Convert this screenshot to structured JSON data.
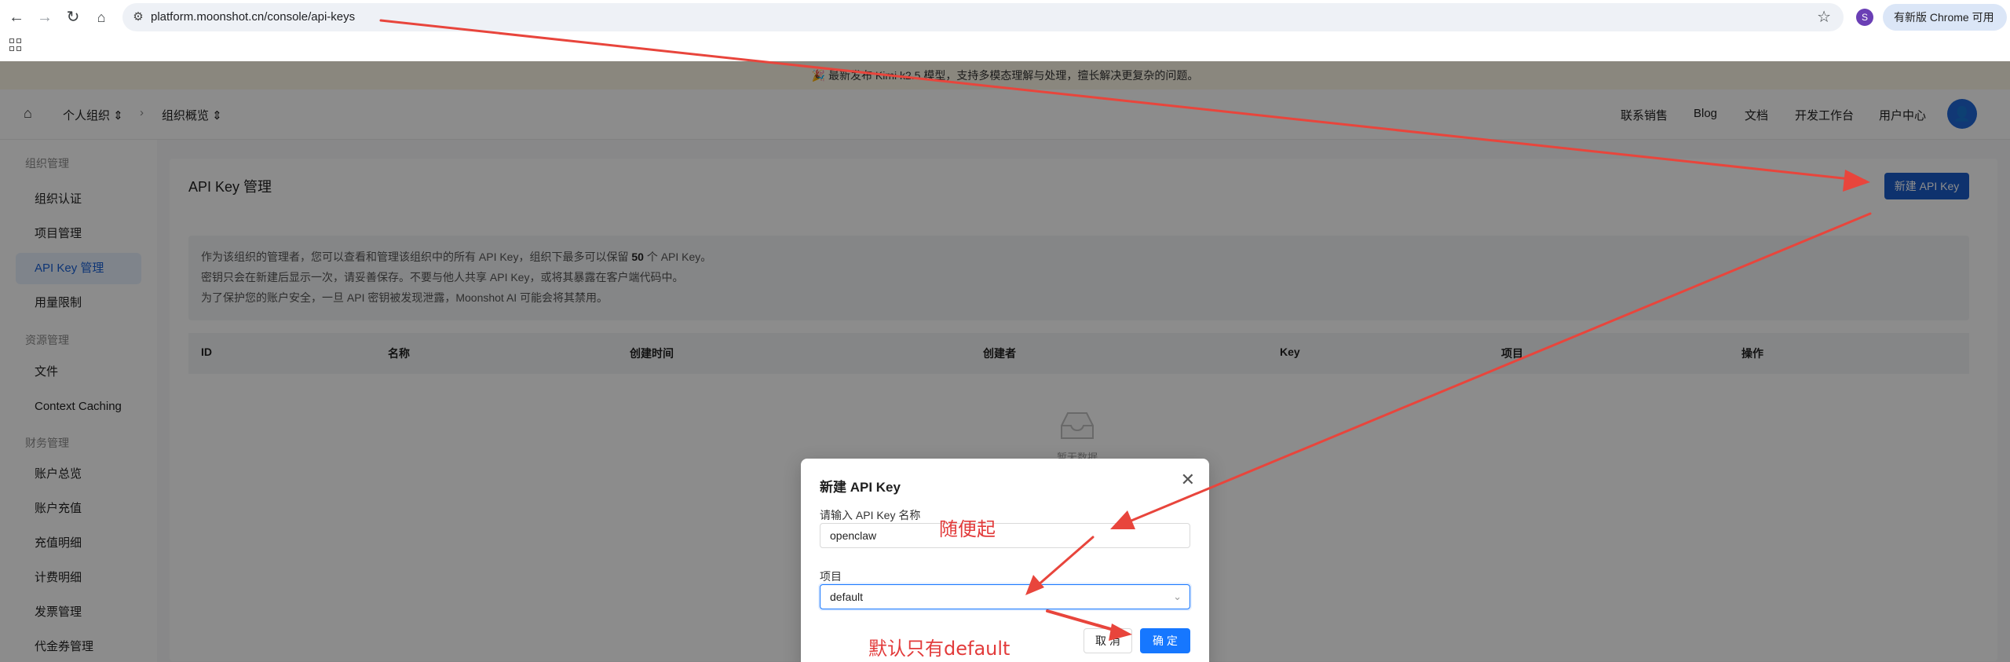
{
  "browser": {
    "url": "platform.moonshot.cn/console/api-keys",
    "profile_initial": "S",
    "update_label": "有新版 Chrome 可用",
    "menu_glyph": "⋮"
  },
  "announcement": "🎉 最新发布 Kimi k2.5 模型，支持多模态理解与处理，擅长解决更复杂的问题。",
  "topnav": {
    "org": "个人组织",
    "section": "组织概览",
    "links": [
      "联系销售",
      "Blog",
      "文档",
      "开发工作台",
      "用户中心"
    ]
  },
  "sidebar": {
    "groups": [
      {
        "label": "组织管理",
        "items": [
          "组织认证",
          "项目管理",
          "API Key 管理",
          "用量限制"
        ]
      },
      {
        "label": "资源管理",
        "items": [
          "文件",
          "Context Caching"
        ]
      },
      {
        "label": "财务管理",
        "items": [
          "账户总览",
          "账户充值",
          "充值明细",
          "计费明细",
          "发票管理",
          "代金券管理"
        ]
      }
    ],
    "active": "API Key 管理"
  },
  "content": {
    "title": "API Key 管理",
    "new_button": "新建 API Key",
    "info_lines": [
      "作为该组织的管理者，您可以查看和管理该组织中的所有 API Key，组织下最多可以保留",
      "50",
      " 个 API Key。",
      "密钥只会在新建后显示一次，请妥善保存。不要与他人共享 API Key，或将其暴露在客户端代码中。",
      "为了保护您的账户安全，一旦 API 密钥被发现泄露，Moonshot AI 可能会将其禁用。"
    ],
    "columns": [
      "ID",
      "名称",
      "创建时间",
      "创建者",
      "Key",
      "项目",
      "操作"
    ],
    "empty_text": "暂无数据"
  },
  "modal": {
    "title": "新建 API Key",
    "name_label": "请输入 API Key 名称",
    "name_value": "openclaw",
    "project_label": "项目",
    "project_value": "default",
    "cancel": "取 消",
    "ok": "确 定"
  },
  "annotations": {
    "name_hint": "随便起",
    "project_hint": "默认只有default",
    "color": "#e23b3b"
  }
}
